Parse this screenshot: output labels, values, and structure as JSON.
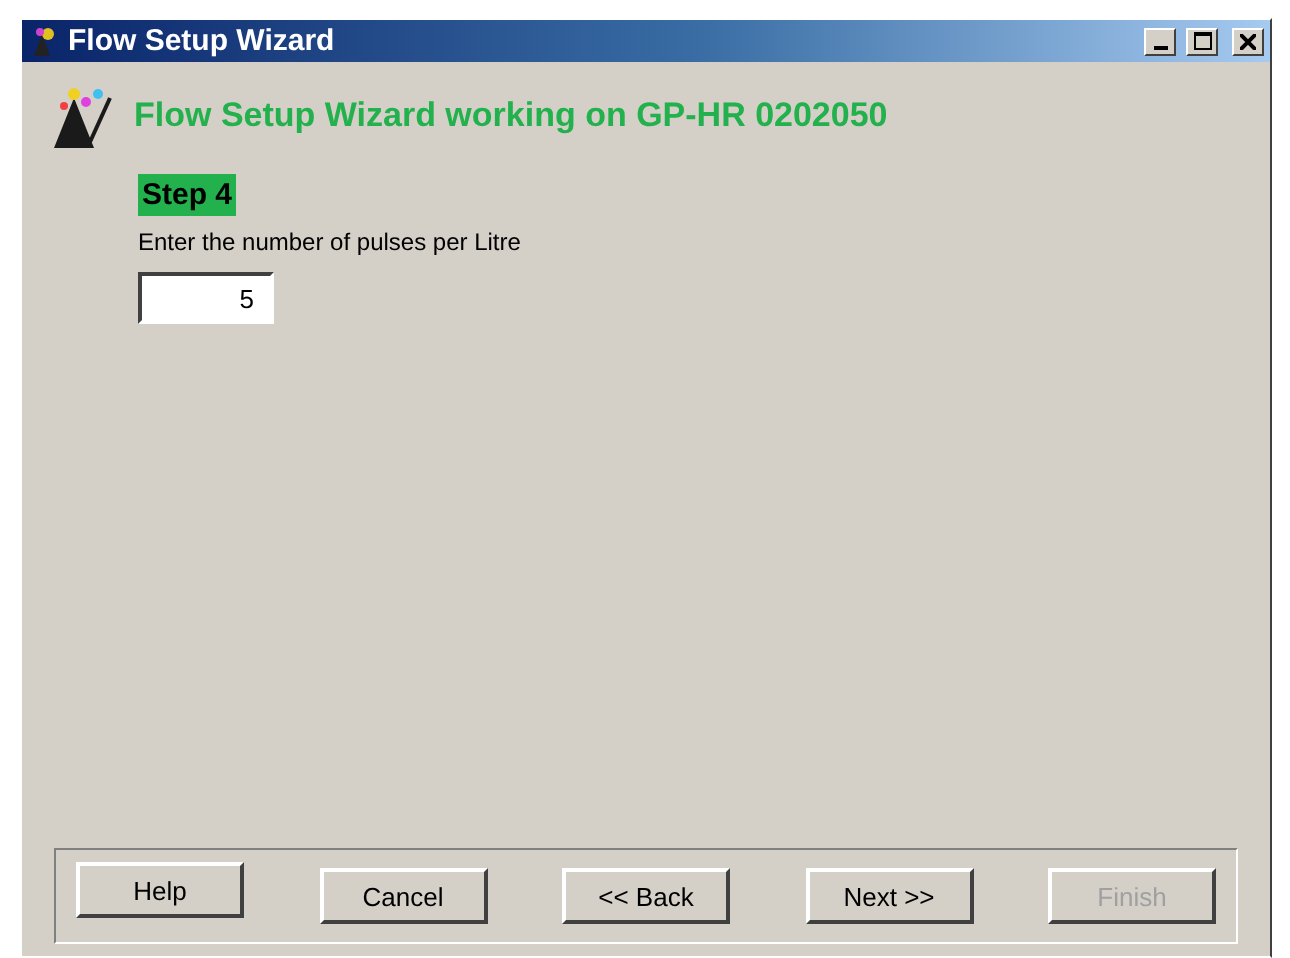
{
  "window": {
    "title": "Flow Setup Wizard"
  },
  "heading": "Flow Setup Wizard working on GP-HR 0202050",
  "step": {
    "label": "Step 4",
    "prompt": "Enter the number of pulses per Litre",
    "value": "5"
  },
  "buttons": [
    {
      "label": "Help",
      "disabled": false
    },
    {
      "label": "Cancel",
      "disabled": false
    },
    {
      "label": "<< Back",
      "disabled": false
    },
    {
      "label": "Next >>",
      "disabled": false
    },
    {
      "label": "Finish",
      "disabled": true
    }
  ]
}
